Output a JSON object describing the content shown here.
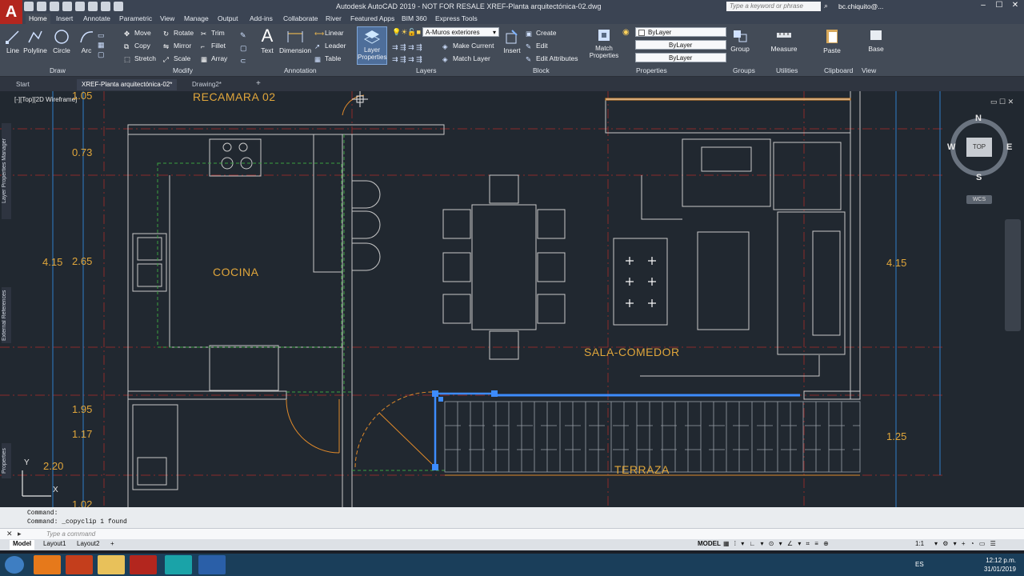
{
  "app": {
    "logo": "A",
    "title": "Autodesk AutoCAD 2019 - NOT FOR RESALE   XREF-Planta arquitectónica-02.dwg",
    "search_placeholder": "Type a keyword or phrase",
    "user": "bc.chiquito@..."
  },
  "ribbon_tabs": [
    "Home",
    "Insert",
    "Annotate",
    "Parametric",
    "View",
    "Manage",
    "Output",
    "Add-ins",
    "Collaborate",
    "River",
    "Featured Apps",
    "BIM 360",
    "Express Tools"
  ],
  "draw_tools": [
    "Line",
    "Polyline",
    "Circle",
    "Arc"
  ],
  "modify_tools": [
    [
      "Move",
      "Rotate",
      "Trim"
    ],
    [
      "Copy",
      "Mirror",
      "Fillet"
    ],
    [
      "Stretch",
      "Scale",
      "Array"
    ]
  ],
  "annotation_tools": {
    "text": "Text",
    "dimension": "Dimension",
    "linear": "Linear",
    "leader": "Leader",
    "table": "Table"
  },
  "layers": {
    "button": "Layer Properties",
    "current": "A-Muros exteriores",
    "make_current": "Make Current",
    "match_layer": "Match Layer"
  },
  "block": {
    "insert": "Insert",
    "create": "Create",
    "edit": "Edit",
    "edit_attributes": "Edit Attributes"
  },
  "properties": {
    "match": "Match Properties",
    "color": "ByLayer",
    "linetype": "ByLayer",
    "lineweight": "ByLayer"
  },
  "other_tools": {
    "group": "Group",
    "measure": "Measure",
    "paste": "Paste",
    "base": "Base"
  },
  "panel_labels": {
    "draw": "Draw",
    "modify": "Modify",
    "annotation": "Annotation",
    "layers": "Layers",
    "block": "Block",
    "properties": "Properties",
    "groups": "Groups",
    "utilities": "Utilities",
    "clipboard": "Clipboard",
    "view": "View"
  },
  "doc_tabs": [
    "Start",
    "XREF-Planta arquitectónica-02*",
    "Drawing2*"
  ],
  "viewport": {
    "label": "[-][Top][2D Wireframe]",
    "rooms": {
      "recamara": "RECAMARA 02",
      "cocina": "COCINA",
      "sala": "SALA-COMEDOR",
      "terraza": "TERRAZA"
    },
    "dims_left": [
      {
        "text": "1.05"
      },
      {
        "text": "0.73"
      },
      {
        "text": "4.15"
      },
      {
        "text": "2.65"
      },
      {
        "text": "1.95"
      },
      {
        "text": "1.17"
      },
      {
        "text": "2.20"
      },
      {
        "text": "1.02"
      }
    ],
    "dims_right": [
      {
        "text": "4.15"
      },
      {
        "text": "1.25"
      }
    ],
    "viewcube": {
      "n": "N",
      "s": "S",
      "e": "E",
      "w": "W",
      "top": "TOP",
      "wcs": "WCS"
    },
    "ucs": {
      "x": "X",
      "y": "Y"
    },
    "palettes": [
      "Layer Properties Manager",
      "External References",
      "Properties"
    ]
  },
  "command": {
    "history": [
      "Command:",
      "Command:  _copyclip 1 found"
    ],
    "placeholder": "Type a command"
  },
  "layout_tabs": [
    "Model",
    "Layout1",
    "Layout2"
  ],
  "status": {
    "model": "MODEL",
    "scale": "1:1"
  },
  "clock": {
    "time": "12:12 p.m.",
    "date": "31/01/2019",
    "lang": "ES"
  }
}
